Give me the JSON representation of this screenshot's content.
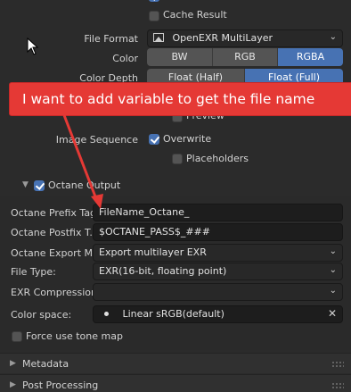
{
  "top": {
    "cache_result_label": "Cache Result",
    "cache_result_checked": false,
    "file_format_label": "File Format",
    "file_format_value": "OpenEXR MultiLayer",
    "color_label": "Color",
    "color_options": [
      "BW",
      "RGB",
      "RGBA"
    ],
    "color_selected": "RGBA",
    "color_depth_label": "Color Depth",
    "color_depth_options": [
      "Float (Half)",
      "Float (Full)"
    ],
    "color_depth_selected": "Float (Full)",
    "preview_label": "Preview",
    "image_sequence_label": "Image Sequence",
    "overwrite_label": "Overwrite",
    "overwrite_checked": true,
    "placeholders_label": "Placeholders",
    "placeholders_checked": false
  },
  "annotation": {
    "text": "I want to add variable to get the file name",
    "color": "#e53935"
  },
  "octane_output": {
    "title": "Octane Output",
    "enabled": true,
    "prefix_label": "Octane Prefix Tag:",
    "prefix_value": "FileName_Octane_",
    "postfix_label": "Octane Postfix T...",
    "postfix_value": "$OCTANE_PASS$_###",
    "export_label": "Octane Export M...",
    "export_value": "Export multilayer EXR",
    "file_type_label": "File Type:",
    "file_type_value": "EXR(16-bit, floating point)",
    "exr_compression_label": "EXR Compression:",
    "exr_compression_value": "",
    "color_space_label": "Color space:",
    "color_space_value": "Linear sRGB(default)",
    "force_tone_map_label": "Force use tone map",
    "force_tone_map_checked": false
  },
  "panels": {
    "metadata": "Metadata",
    "post_processing": "Post Processing"
  },
  "colors": {
    "accent": "#4772b3",
    "background": "#2b2b2b",
    "annotation_red": "#e53935"
  }
}
